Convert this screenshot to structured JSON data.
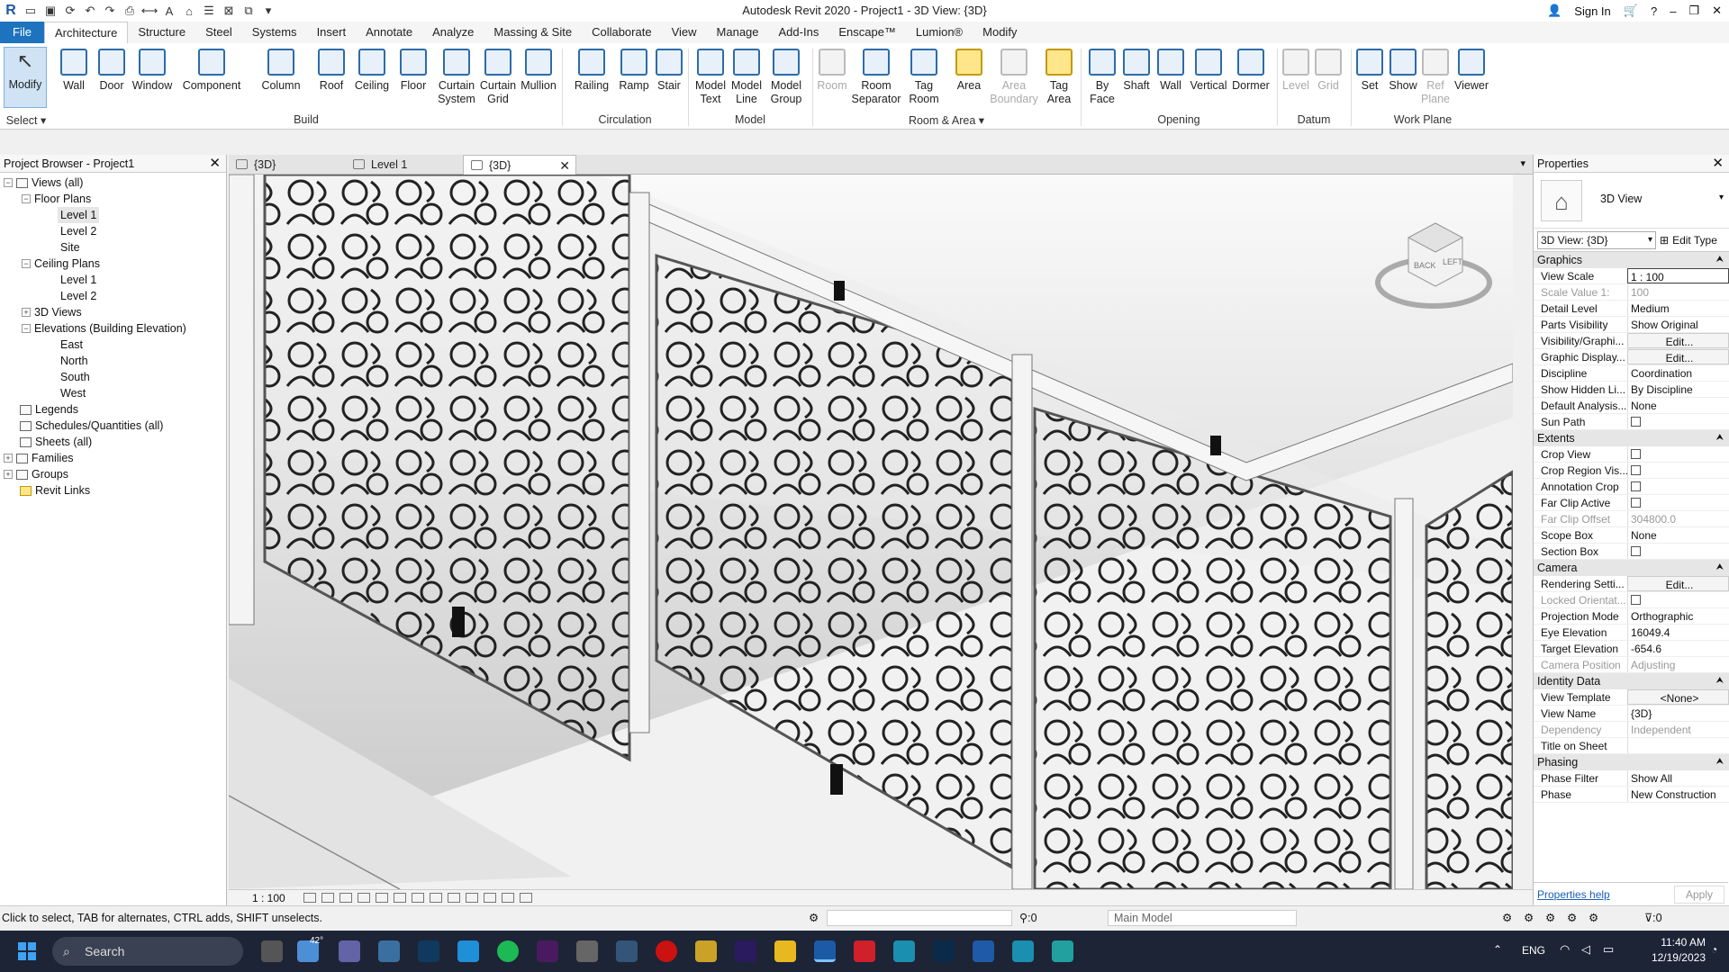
{
  "title": "Autodesk Revit 2020 - Project1 - 3D View: {3D}",
  "sign_in": "Sign In",
  "menu": [
    "File",
    "Architecture",
    "Structure",
    "Steel",
    "Systems",
    "Insert",
    "Annotate",
    "Analyze",
    "Massing & Site",
    "Collaborate",
    "View",
    "Manage",
    "Add-Ins",
    "Enscape™",
    "Lumion®",
    "Modify"
  ],
  "ribbon": {
    "buttons": [
      "Modify",
      "Wall",
      "Door",
      "Window",
      "Component",
      "Column",
      "Roof",
      "Ceiling",
      "Floor",
      "Curtain\nSystem",
      "Curtain\nGrid",
      "Mullion",
      "Railing",
      "Ramp",
      "Stair",
      "Model\nText",
      "Model\nLine",
      "Model\nGroup",
      "Room",
      "Room\nSeparator",
      "Tag\nRoom",
      "Area",
      "Area\nBoundary",
      "Tag\nArea",
      "By\nFace",
      "Shaft",
      "Wall",
      "Vertical",
      "Dormer",
      "Level",
      "Grid",
      "Set",
      "Show",
      "Ref\nPlane",
      "Viewer"
    ],
    "panels": [
      "Select",
      "Build",
      "Circulation",
      "Model",
      "Room & Area",
      "Opening",
      "Datum",
      "Work Plane"
    ]
  },
  "browser": {
    "title": "Project Browser - Project1",
    "items": [
      "Views (all)",
      "Floor Plans",
      "Level 1",
      "Level 2",
      "Site",
      "Ceiling Plans",
      "Level 1",
      "Level 2",
      "3D Views",
      "Elevations (Building Elevation)",
      "East",
      "North",
      "South",
      "West",
      "Legends",
      "Schedules/Quantities (all)",
      "Sheets (all)",
      "Families",
      "Groups",
      "Revit Links"
    ]
  },
  "view_tabs": [
    "{3D}",
    "Level 1",
    "{3D}"
  ],
  "viewcube": {
    "back": "BACK",
    "left": "LEFT"
  },
  "view_control": {
    "scale": "1 : 100"
  },
  "properties": {
    "title": "Properties",
    "type": "3D View",
    "selector": "3D View: {3D}",
    "edit_type": "Edit Type",
    "groups": [
      {
        "name": "Graphics",
        "rows": [
          [
            "View Scale",
            "1 : 100"
          ],
          [
            "Scale Value    1:",
            "100"
          ],
          [
            "Detail Level",
            "Medium"
          ],
          [
            "Parts Visibility",
            "Show Original"
          ],
          [
            "Visibility/Graphi...",
            "Edit..."
          ],
          [
            "Graphic Display...",
            "Edit..."
          ],
          [
            "Discipline",
            "Coordination"
          ],
          [
            "Show Hidden Li...",
            "By Discipline"
          ],
          [
            "Default Analysis...",
            "None"
          ],
          [
            "Sun Path",
            ""
          ]
        ]
      },
      {
        "name": "Extents",
        "rows": [
          [
            "Crop View",
            ""
          ],
          [
            "Crop Region Vis...",
            ""
          ],
          [
            "Annotation Crop",
            ""
          ],
          [
            "Far Clip Active",
            ""
          ],
          [
            "Far Clip Offset",
            "304800.0"
          ],
          [
            "Scope Box",
            "None"
          ],
          [
            "Section Box",
            ""
          ]
        ]
      },
      {
        "name": "Camera",
        "rows": [
          [
            "Rendering Setti...",
            "Edit..."
          ],
          [
            "Locked Orientat...",
            ""
          ],
          [
            "Projection Mode",
            "Orthographic"
          ],
          [
            "Eye Elevation",
            "16049.4"
          ],
          [
            "Target Elevation",
            "-654.6"
          ],
          [
            "Camera Position",
            "Adjusting"
          ]
        ]
      },
      {
        "name": "Identity Data",
        "rows": [
          [
            "View Template",
            "<None>"
          ],
          [
            "View Name",
            "{3D}"
          ],
          [
            "Dependency",
            "Independent"
          ],
          [
            "Title on Sheet",
            ""
          ]
        ]
      },
      {
        "name": "Phasing",
        "rows": [
          [
            "Phase Filter",
            "Show All"
          ],
          [
            "Phase",
            "New Construction"
          ]
        ]
      }
    ],
    "help": "Properties help",
    "apply": "Apply"
  },
  "status": {
    "hint": "Click to select, TAB for alternates, CTRL adds, SHIFT unselects.",
    "sel_count": ":0",
    "model": "Main Model",
    "filter": ":0"
  },
  "taskbar": {
    "search": "Search",
    "temp": "42°",
    "lang": "ENG",
    "time": "11:40 AM",
    "date": "12/19/2023"
  }
}
